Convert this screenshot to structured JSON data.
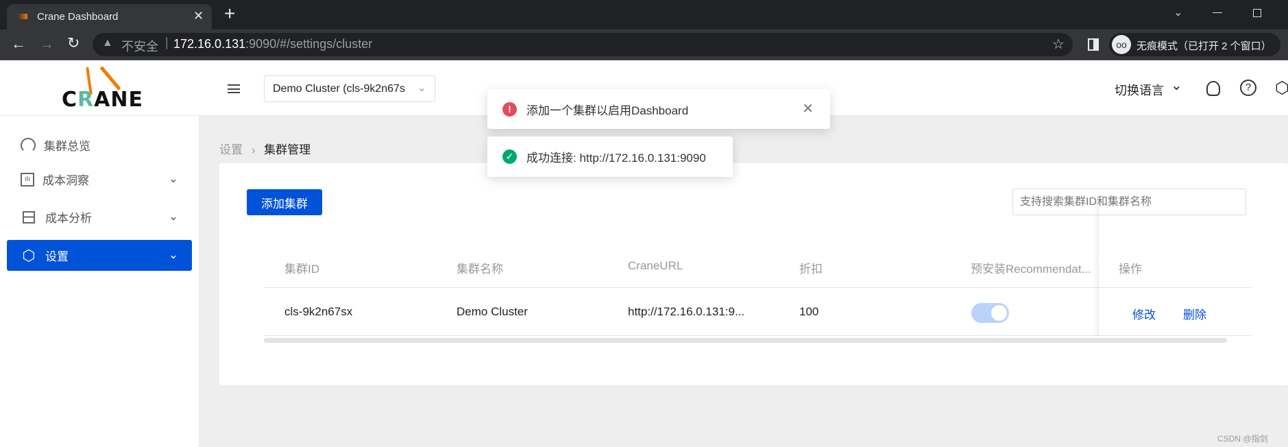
{
  "browser": {
    "tab_title": "Crane Dashboard",
    "security_label": "不安全",
    "url_host": "172.16.0.131",
    "url_rest": ":9090/#/settings/cluster",
    "incognito_label": "无痕模式（已打开 2 个窗口）"
  },
  "header": {
    "logo_text": "CRANE",
    "cluster_select": "Demo Cluster (cls-9k2n67s",
    "language": "切换语言"
  },
  "sidebar": {
    "items": [
      {
        "label": "集群总览",
        "icon": "dashboard-gauge-icon"
      },
      {
        "label": "成本洞察",
        "icon": "chart-bar-icon"
      },
      {
        "label": "成本分析",
        "icon": "layers-icon"
      },
      {
        "label": "设置",
        "icon": "gear-icon",
        "active": true
      }
    ]
  },
  "breadcrumb": {
    "parent": "设置",
    "current": "集群管理"
  },
  "toolbar": {
    "add_label": "添加集群",
    "search_placeholder": "支持搜索集群ID和集群名称"
  },
  "table": {
    "headers": [
      "集群ID",
      "集群名称",
      "CraneURL",
      "折扣",
      "预安装Recommendat...",
      "操作"
    ],
    "rows": [
      {
        "id": "cls-9k2n67sx",
        "name": "Demo Cluster",
        "url": "http://172.16.0.131:9...",
        "discount": "100",
        "preinstall": true,
        "edit": "修改",
        "delete": "删除"
      }
    ]
  },
  "toasts": [
    {
      "type": "error",
      "text": "添加一个集群以启用Dashboard"
    },
    {
      "type": "success",
      "text": "成功连接: http://172.16.0.131:9090"
    }
  ],
  "watermark": "CSDN @指剑",
  "colors": {
    "primary": "#0052d9",
    "error": "#e34d59",
    "success": "#00a870",
    "toggle": "#bbd3fb"
  }
}
